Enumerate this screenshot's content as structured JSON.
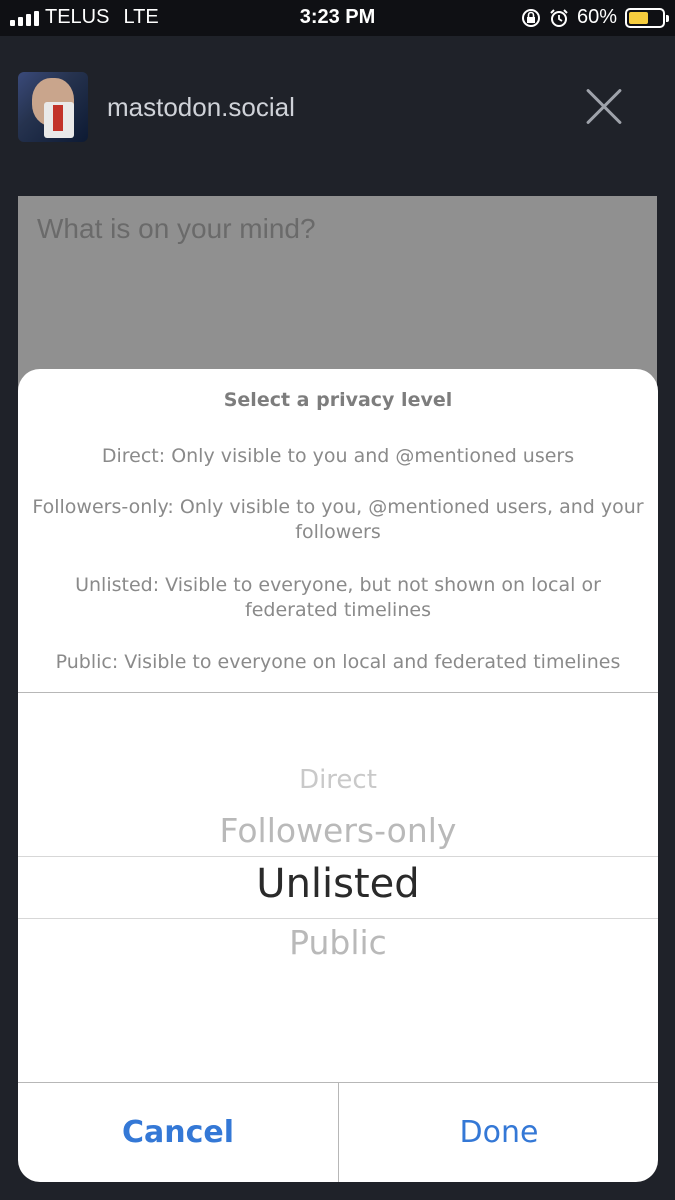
{
  "status_bar": {
    "carrier": "TELUS",
    "network": "LTE",
    "time": "3:23 PM",
    "battery": "60%",
    "battery_level": 0.6,
    "icons": [
      "signal-icon",
      "rotation-lock-icon",
      "alarm-icon",
      "battery-icon"
    ],
    "battery_color": "#f5cc3e"
  },
  "compose": {
    "instance": "mastodon.social",
    "placeholder": "What is on your mind?",
    "close_icon": "close-icon"
  },
  "privacy_sheet": {
    "title": "Select a privacy level",
    "descriptions": [
      "Direct: Only visible to you and @mentioned users",
      "Followers-only: Only visible to you, @mentioned users, and your followers",
      "Unlisted: Visible to everyone, but not shown on local or federated timelines",
      "Public: Visible to everyone on local and federated timelines"
    ],
    "options": [
      "Direct",
      "Followers-only",
      "Unlisted",
      "Public"
    ],
    "selected": "Unlisted",
    "cancel_label": "Cancel",
    "done_label": "Done",
    "accent_color": "#3478d6"
  }
}
